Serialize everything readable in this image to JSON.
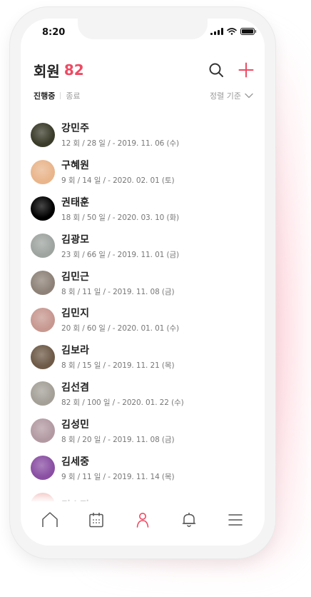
{
  "status_bar": {
    "time": "8:20"
  },
  "header": {
    "title": "회원",
    "count": "82"
  },
  "filters": {
    "active_tab": "진행중",
    "tab_2": "종료",
    "sort_label": "정렬 기준"
  },
  "colors": {
    "accent": "#ee4a62",
    "text": "#222222",
    "muted": "#777777"
  },
  "members": [
    {
      "name": "강민주",
      "info": "12 회 / 28 일 / - 2019. 11. 06 (수)",
      "avatar": "#3b3b2a"
    },
    {
      "name": "구혜원",
      "info": "9 회 / 14 일 / - 2020. 02. 01 (토)",
      "avatar": "#e9b58b"
    },
    {
      "name": "권태훈",
      "info": "18 회 / 50 일 / - 2020. 03. 10 (화)",
      "avatar": "#000000"
    },
    {
      "name": "김광모",
      "info": "23 회 / 66 일 / - 2019. 11. 01 (금)",
      "avatar": "#9ea4a0"
    },
    {
      "name": "김민근",
      "info": "8 회 / 11 일 / - 2019. 11. 08 (금)",
      "avatar": "#8e8278"
    },
    {
      "name": "김민지",
      "info": "20 회 / 60 일 / - 2020. 01. 01 (수)",
      "avatar": "#c79890"
    },
    {
      "name": "김보라",
      "info": "8 회 / 15 일 / - 2019. 11. 21 (목)",
      "avatar": "#6e5a47"
    },
    {
      "name": "김선겸",
      "info": "82 회 / 100 일 / - 2020. 01. 22 (수)",
      "avatar": "#a4a098"
    },
    {
      "name": "김성민",
      "info": "8 회 / 20 일 / - 2019. 11. 08 (금)",
      "avatar": "#b39aa2"
    },
    {
      "name": "김세중",
      "info": "9 회 / 11 일 / - 2019. 11. 14 (목)",
      "avatar": "#8a4fa3"
    },
    {
      "name": "김소정",
      "info": "",
      "avatar": "#f3c7c4"
    }
  ],
  "tabbar": {
    "items": [
      {
        "icon": "home-icon",
        "active": false
      },
      {
        "icon": "calendar-icon",
        "active": false
      },
      {
        "icon": "person-icon",
        "active": true
      },
      {
        "icon": "bell-icon",
        "active": false
      },
      {
        "icon": "menu-icon",
        "active": false
      }
    ]
  }
}
